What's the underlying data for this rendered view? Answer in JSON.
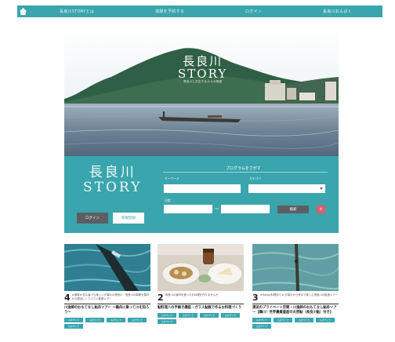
{
  "nav": {
    "items": [
      "長良川STORYとは",
      "体験を予約する",
      "ログイン",
      "長良川おんぱく"
    ]
  },
  "hero": {
    "logo_line1": "長良川",
    "logo_line2": "STORY",
    "logo_line3": "長良川と共生する人々の物語"
  },
  "search_panel": {
    "logo_line1": "長良川",
    "logo_line2": "STORY",
    "login_label": "ログイン",
    "register_label": "新規登録",
    "title": "プログラムをさがす",
    "keyword_label": "キーワード",
    "category_label": "カテゴリ",
    "date_label": "日程",
    "date_separator": "〜",
    "search_label": "検索",
    "clear_label": "×"
  },
  "cards": [
    {
      "num": "4",
      "subtitle": "★満席★ 初心者でも楽しい夕暮れの長良川・長良川の鵜飼を鵜舟から間近に！ワイワイ鵜飼ツアー",
      "title": "川漁師のおもてなし鮎舟ツアー 〜鵜舟に乗って川を知ろう〜",
      "tags": [
        "ものづくり",
        "ものづくり",
        "ものづくり",
        "ものづくり",
        "ものづくり"
      ]
    },
    {
      "num": "2",
      "subtitle": "長良川の食材を使ったお料理を作りませんか",
      "title": "鮎料理人の手解き講座・ガラス鮎飯で作るお料理づくり",
      "tags": [
        "ものづくり",
        "ものづくり",
        "ものづくり",
        "ものづくり",
        "ものづくり"
      ]
    },
    {
      "num": "3",
      "subtitle": "★Happy料理あり★ 夕暮れから夜まで楽しむ長良川の鮎漁ツアー",
      "title": "清流のプライベート空間 / 川漁師のおもてなし鮎舟ツアー【鵜川！世界農業遺産の天然鮎（長良川鮎）付き】",
      "tags": [
        "ものづくり",
        "ものづくり",
        "ものづくり",
        "ものづくり",
        "ものづくり"
      ]
    }
  ],
  "colors": {
    "accent": "#3aa5ad",
    "dark_button": "#5b5f63",
    "clear_button": "#e05d67"
  },
  "icons": {
    "home": "home-icon"
  }
}
